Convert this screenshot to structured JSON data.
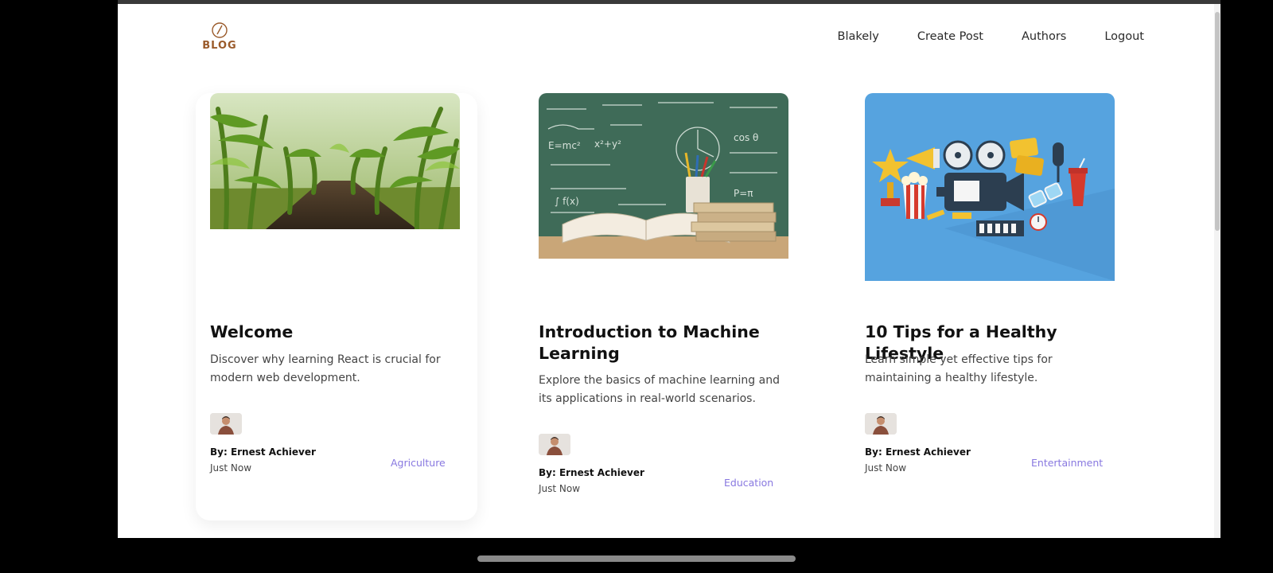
{
  "logo": {
    "text": "BLOG"
  },
  "nav": {
    "items": [
      "Blakely",
      "Create Post",
      "Authors",
      "Logout"
    ]
  },
  "posts": [
    {
      "image": "corn-field-image",
      "title": "Welcome",
      "excerpt": "Discover why learning React is crucial for modern web development.",
      "author": "By: Ernest Achiever",
      "time": "Just Now",
      "category": "Agriculture"
    },
    {
      "image": "chalkboard-books-image",
      "title": "Introduction to Machine Learning",
      "excerpt": "Explore the basics of machine learning and its applications in real-world scenarios.",
      "author": "By: Ernest Achiever",
      "time": "Just Now",
      "category": "Education"
    },
    {
      "image": "cinema-illustration-image",
      "title": "10 Tips for a Healthy Lifestyle",
      "excerpt": "Learn simple yet effective tips for maintaining a healthy lifestyle.",
      "author": "By: Ernest Achiever",
      "time": "Just Now",
      "category": "Entertainment"
    }
  ],
  "colors": {
    "logo": "#9a5a2a",
    "category": "#8878e0",
    "cinema_bg": "#56a3df"
  }
}
